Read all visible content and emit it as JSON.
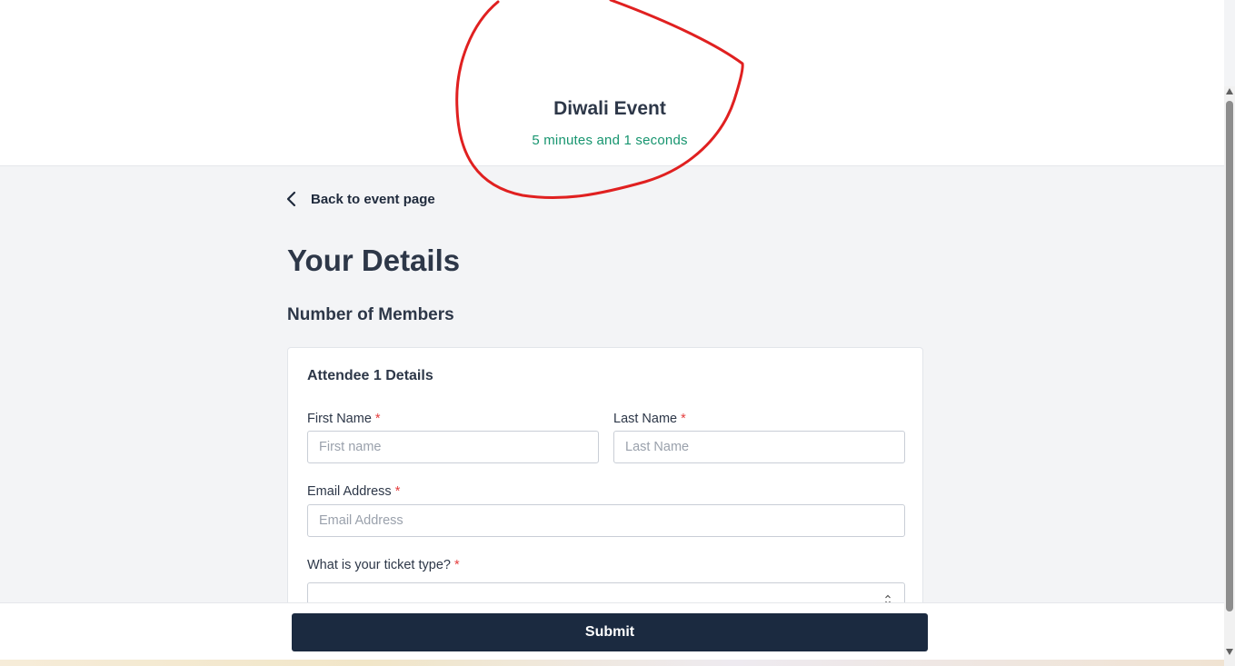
{
  "header": {
    "event_title": "Diwali Event",
    "timer_text": "5 minutes and 1 seconds"
  },
  "nav": {
    "back_label": "Back to event page"
  },
  "page": {
    "title": "Your Details",
    "members_section": "Number of Members"
  },
  "attendee_card": {
    "title": "Attendee 1 Details",
    "first_name": {
      "label": "First Name",
      "required_mark": "*",
      "placeholder": "First name",
      "value": ""
    },
    "last_name": {
      "label": "Last Name",
      "required_mark": "*",
      "placeholder": "Last Name",
      "value": ""
    },
    "email": {
      "label": "Email Address",
      "required_mark": "*",
      "placeholder": "Email Address",
      "value": ""
    },
    "ticket_type": {
      "label": "What is your ticket type?",
      "required_mark": "*",
      "selected": ""
    }
  },
  "footer": {
    "submit_label": "Submit"
  },
  "colors": {
    "timer": "#17956f",
    "submit_bg": "#1b2a40",
    "required": "#e53e3e",
    "annotation": "#e02020"
  },
  "icons": {
    "back": "chevron-left-icon",
    "select": "chevron-up-down-icon"
  }
}
